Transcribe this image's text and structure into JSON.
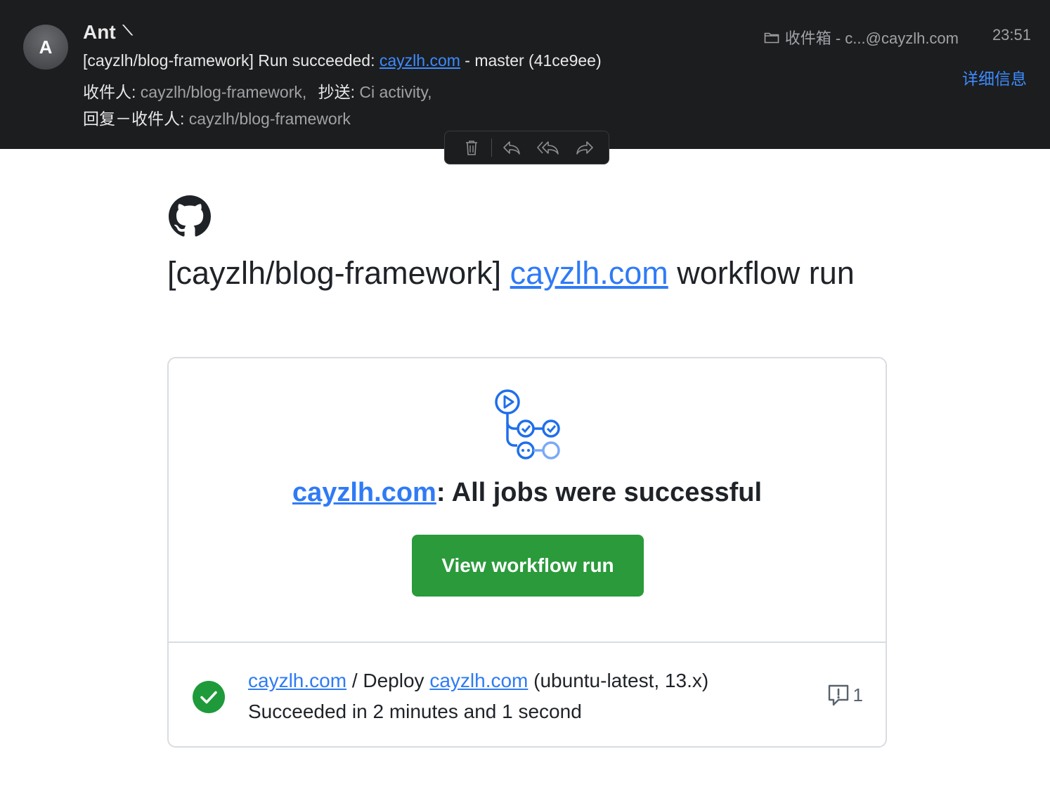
{
  "header": {
    "avatar_letter": "A",
    "sender": "Ant",
    "subject_prefix": "[cayzlh/blog-framework] Run succeeded: ",
    "subject_link": "cayzlh.com",
    "subject_suffix": " - master (41ce9ee)",
    "to_label": "收件人:",
    "to_value": "cayzlh/blog-framework,",
    "cc_label": "抄送:",
    "cc_value": "Ci activity,",
    "reply_label": "回复－收件人:",
    "reply_value": "cayzlh/blog-framework",
    "mailbox": "收件箱 - c...@cayzlh.com",
    "time": "23:51",
    "details": "详细信息"
  },
  "toolbar": {
    "icons": [
      "trash-icon",
      "reply-icon",
      "reply-all-icon",
      "forward-icon"
    ]
  },
  "email": {
    "title_prefix": "[cayzlh/blog-framework] ",
    "title_link": "cayzlh.com",
    "title_suffix": " workflow run",
    "status_link": "cayzlh.com",
    "status_text": ": All jobs were successful",
    "button_label": "View workflow run",
    "job": {
      "workflow_link": "cayzlh.com",
      "sep": " / Deploy ",
      "job_link": "cayzlh.com",
      "job_suffix": " (ubuntu-latest, 13.x)",
      "duration": "Succeeded in 2 minutes and 1 second",
      "annotation_count": "1"
    }
  },
  "colors": {
    "header_bg": "#1c1d1f",
    "link": "#2f7bf6",
    "success_green": "#2a9a3a",
    "check_green": "#1f9a3a"
  }
}
